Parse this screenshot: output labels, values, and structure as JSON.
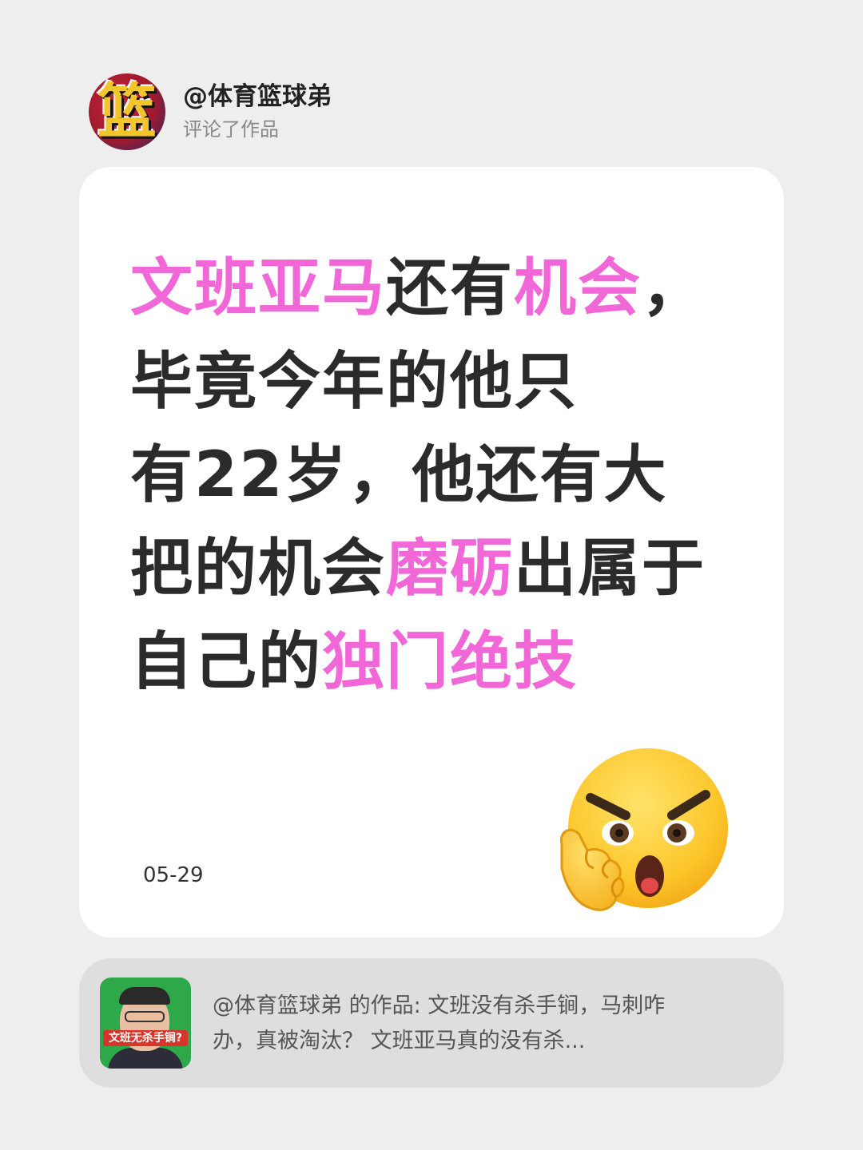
{
  "header": {
    "avatar_glyph": "篮",
    "username": "@体育篮球弟",
    "subtitle": "评论了作品"
  },
  "comment": {
    "lines": [
      [
        {
          "text": "文班亚马",
          "highlight": true
        },
        {
          "text": "还有",
          "highlight": false
        },
        {
          "text": "机会",
          "highlight": true
        },
        {
          "text": "，",
          "highlight": false
        }
      ],
      [
        {
          "text": "毕竟今年的他只",
          "highlight": false
        }
      ],
      [
        {
          "text": "有22岁，他还有大",
          "highlight": false
        }
      ],
      [
        {
          "text": "把的机会",
          "highlight": false
        },
        {
          "text": "磨砺",
          "highlight": true
        },
        {
          "text": "出属于",
          "highlight": false
        }
      ],
      [
        {
          "text": "自己的",
          "highlight": false
        },
        {
          "text": "独门绝技",
          "highlight": true
        }
      ]
    ],
    "date": "05-29",
    "emoji": "thinking-angry-face-emoji"
  },
  "reference": {
    "thumbnail_caption": "文班无杀手锏?",
    "line1": "@体育篮球弟 的作品: 文班没有杀手锏，马刺咋",
    "line2": "办，真被淘汰？ 文班亚马真的没有杀..."
  },
  "colors": {
    "highlight": "#f267d8",
    "text": "#2b2b2b",
    "background": "#eeeeee",
    "card": "#ffffff",
    "ref_card": "#dedede"
  }
}
